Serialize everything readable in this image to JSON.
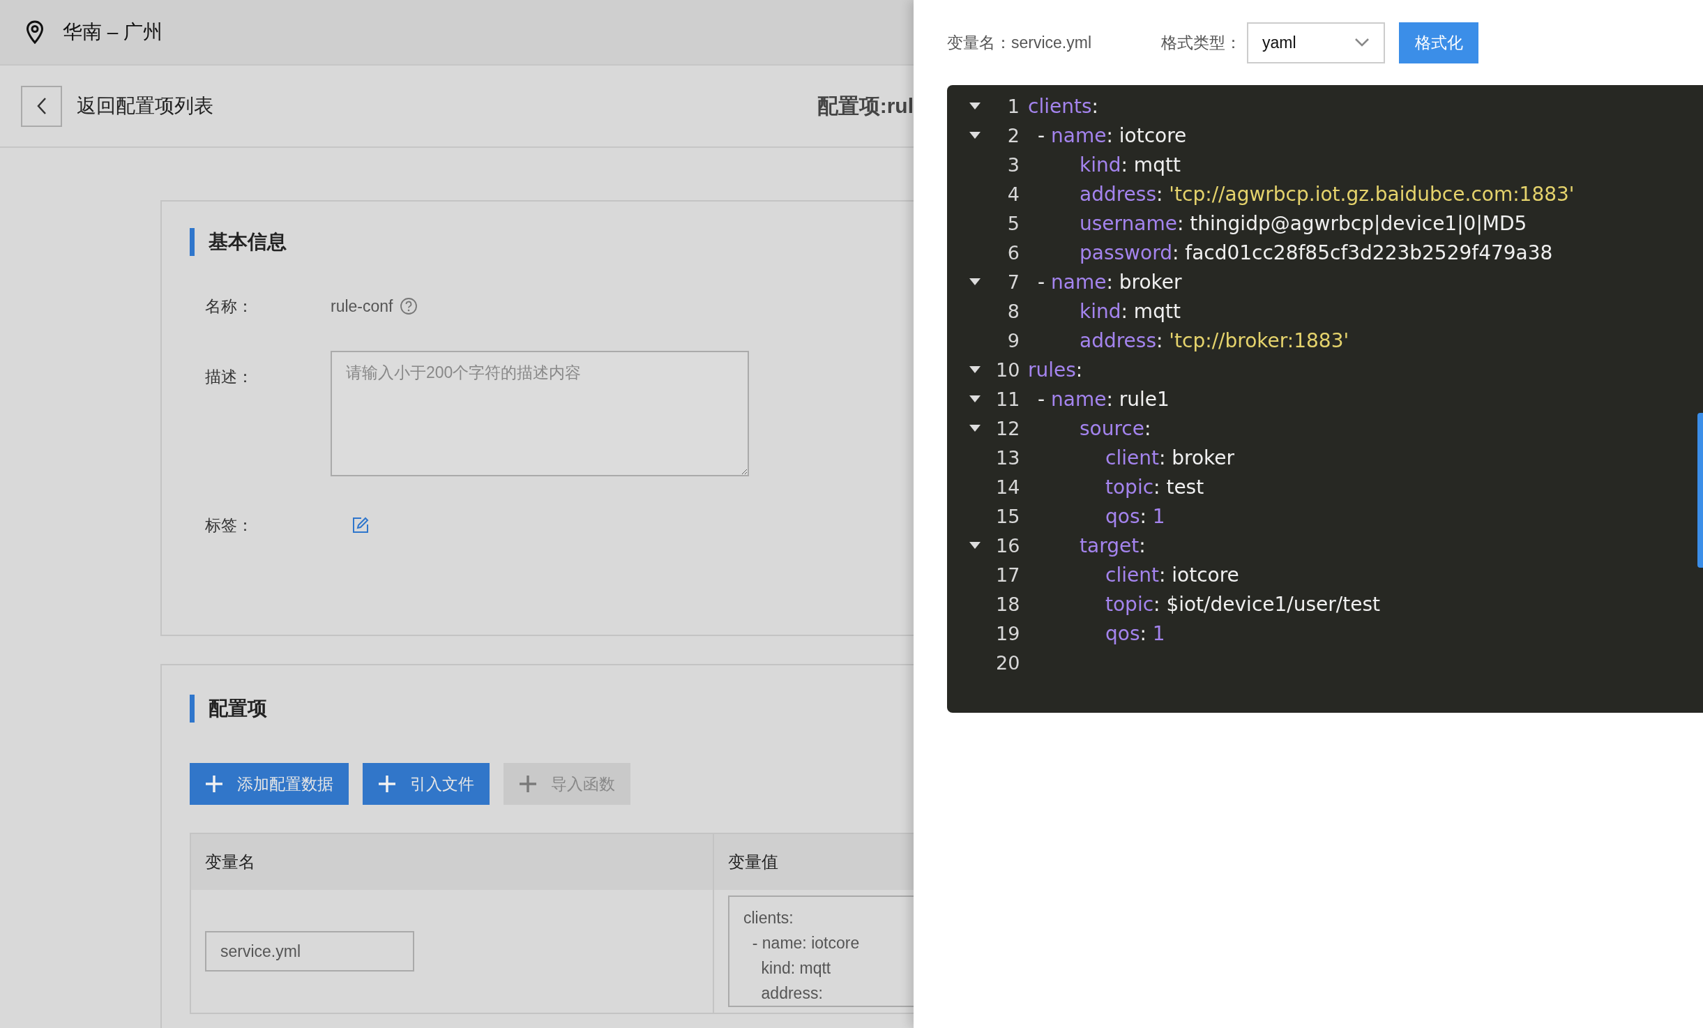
{
  "top_bar": {
    "region": "华南 – 广州"
  },
  "page_header": {
    "back_label": "返回配置项列表",
    "title": "配置项:rul"
  },
  "basic_info": {
    "title": "基本信息",
    "fields": [
      {
        "kind": "text",
        "label": "名称：",
        "value": "rule-conf"
      },
      {
        "kind": "textarea",
        "label": "描述：",
        "placeholder": "请输入小于200个字符的描述内容"
      },
      {
        "kind": "tags",
        "label": "标签："
      }
    ]
  },
  "config_items": {
    "title": "配置项",
    "buttons": [
      {
        "label": "添加配置数据",
        "disabled": false
      },
      {
        "label": "引入文件",
        "disabled": false
      },
      {
        "label": "导入函数",
        "disabled": true
      }
    ],
    "table": {
      "columns": [
        "变量名",
        "变量值"
      ],
      "rows": [
        {
          "name": "service.yml",
          "value": "clients:\n  - name: iotcore\n    kind: mqtt\n    address:"
        }
      ]
    }
  },
  "drawer": {
    "name_label": "变量名：",
    "name_value": "service.yml",
    "format_label": "格式类型：",
    "format_select": "yaml",
    "format_button": "格式化",
    "editor": {
      "lines": [
        {
          "number": "1",
          "foldable": true,
          "tokens": [
            {
              "kind": "key",
              "text": "clients"
            },
            {
              "kind": "plain",
              "text": ":"
            }
          ],
          "children": [
            {
              "number": "2",
              "foldable": true,
              "tokens": [
                {
                  "kind": "plain",
                  "text": "- "
                },
                {
                  "kind": "key",
                  "text": "name"
                },
                {
                  "kind": "plain",
                  "text": ": iotcore"
                }
              ],
              "children": [
                {
                  "number": "3",
                  "foldable": false,
                  "tokens": [
                    {
                      "kind": "key",
                      "text": "kind"
                    },
                    {
                      "kind": "plain",
                      "text": ": mqtt"
                    }
                  ]
                },
                {
                  "number": "4",
                  "foldable": false,
                  "tokens": [
                    {
                      "kind": "key",
                      "text": "address"
                    },
                    {
                      "kind": "plain",
                      "text": ": "
                    },
                    {
                      "kind": "string",
                      "text": "'tcp://agwrbcp.iot.gz.baidubce.com:1883'"
                    }
                  ]
                },
                {
                  "number": "5",
                  "foldable": false,
                  "tokens": [
                    {
                      "kind": "key",
                      "text": "username"
                    },
                    {
                      "kind": "plain",
                      "text": ": thingidp@agwrbcp|device1|0|MD5"
                    }
                  ]
                },
                {
                  "number": "6",
                  "foldable": false,
                  "tokens": [
                    {
                      "kind": "key",
                      "text": "password"
                    },
                    {
                      "kind": "plain",
                      "text": ": facd01cc28f85cf3d223b2529f479a38"
                    }
                  ]
                }
              ]
            },
            {
              "number": "7",
              "foldable": true,
              "tokens": [
                {
                  "kind": "plain",
                  "text": "- "
                },
                {
                  "kind": "key",
                  "text": "name"
                },
                {
                  "kind": "plain",
                  "text": ": broker"
                }
              ],
              "children": [
                {
                  "number": "8",
                  "foldable": false,
                  "tokens": [
                    {
                      "kind": "key",
                      "text": "kind"
                    },
                    {
                      "kind": "plain",
                      "text": ": mqtt"
                    }
                  ]
                },
                {
                  "number": "9",
                  "foldable": false,
                  "tokens": [
                    {
                      "kind": "key",
                      "text": "address"
                    },
                    {
                      "kind": "plain",
                      "text": ": "
                    },
                    {
                      "kind": "string",
                      "text": "'tcp://broker:1883'"
                    }
                  ]
                }
              ]
            }
          ]
        },
        {
          "number": "10",
          "foldable": true,
          "tokens": [
            {
              "kind": "key",
              "text": "rules"
            },
            {
              "kind": "plain",
              "text": ":"
            }
          ],
          "children": [
            {
              "number": "11",
              "foldable": true,
              "tokens": [
                {
                  "kind": "plain",
                  "text": "- "
                },
                {
                  "kind": "key",
                  "text": "name"
                },
                {
                  "kind": "plain",
                  "text": ": rule1"
                }
              ],
              "children": [
                {
                  "number": "12",
                  "foldable": true,
                  "tokens": [
                    {
                      "kind": "key",
                      "text": "source"
                    },
                    {
                      "kind": "plain",
                      "text": ":"
                    }
                  ],
                  "children": [
                    {
                      "number": "13",
                      "foldable": false,
                      "tokens": [
                        {
                          "kind": "key",
                          "text": "client"
                        },
                        {
                          "kind": "plain",
                          "text": ": broker"
                        }
                      ]
                    },
                    {
                      "number": "14",
                      "foldable": false,
                      "tokens": [
                        {
                          "kind": "key",
                          "text": "topic"
                        },
                        {
                          "kind": "plain",
                          "text": ": test"
                        }
                      ]
                    },
                    {
                      "number": "15",
                      "foldable": false,
                      "tokens": [
                        {
                          "kind": "key",
                          "text": "qos"
                        },
                        {
                          "kind": "plain",
                          "text": ": "
                        },
                        {
                          "kind": "number",
                          "text": "1"
                        }
                      ]
                    }
                  ]
                },
                {
                  "number": "16",
                  "foldable": true,
                  "tokens": [
                    {
                      "kind": "key",
                      "text": "target"
                    },
                    {
                      "kind": "plain",
                      "text": ":"
                    }
                  ],
                  "children": [
                    {
                      "number": "17",
                      "foldable": false,
                      "tokens": [
                        {
                          "kind": "key",
                          "text": "client"
                        },
                        {
                          "kind": "plain",
                          "text": ": iotcore"
                        }
                      ]
                    },
                    {
                      "number": "18",
                      "foldable": false,
                      "tokens": [
                        {
                          "kind": "key",
                          "text": "topic"
                        },
                        {
                          "kind": "plain",
                          "text": ": $iot/device1/user/test"
                        }
                      ]
                    },
                    {
                      "number": "19",
                      "foldable": false,
                      "tokens": [
                        {
                          "kind": "key",
                          "text": "qos"
                        },
                        {
                          "kind": "plain",
                          "text": ": "
                        },
                        {
                          "kind": "number",
                          "text": "1"
                        }
                      ]
                    }
                  ]
                }
              ]
            }
          ]
        },
        {
          "number": "20",
          "foldable": false
        }
      ]
    }
  }
}
